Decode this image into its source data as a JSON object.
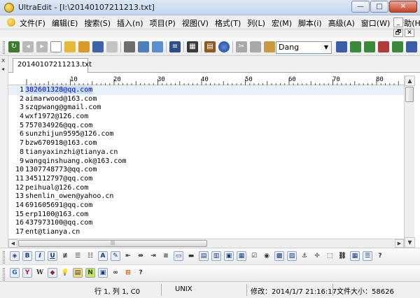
{
  "window": {
    "title": "UltraEdit - [I:\\20140107211213.txt]",
    "minimize": "—",
    "maximize": "□",
    "close": "✕"
  },
  "menu": {
    "items": [
      "文件(F)",
      "编辑(E)",
      "搜索(S)",
      "插入(n)",
      "项目(P)",
      "视图(V)",
      "格式(T)",
      "列(L)",
      "宏(M)",
      "脚本(i)",
      "高级(A)",
      "窗口(W)",
      "帮助(H)"
    ],
    "mdi_minimize": "_",
    "mdi_restore": "🗗",
    "mdi_close": "✕"
  },
  "toolbar": {
    "combo_value": "Dang"
  },
  "tab": {
    "filename": "20140107211213.txt",
    "side_close": "x",
    "side_arrow": "◂"
  },
  "ruler": {
    "labels": [
      "10",
      "20",
      "30",
      "40",
      "50",
      "60",
      "70",
      "80"
    ]
  },
  "editor": {
    "lines": [
      {
        "n": "1",
        "text": "382601328@qq.com"
      },
      {
        "n": "2",
        "text": "aimarwood@163.com"
      },
      {
        "n": "3",
        "text": "szqpwang@gmail.com"
      },
      {
        "n": "4",
        "text": "wxf1972@126.com"
      },
      {
        "n": "5",
        "text": "757034926@qq.com"
      },
      {
        "n": "6",
        "text": "sunzhijun9595@126.com"
      },
      {
        "n": "7",
        "text": "bzw670918@163.com"
      },
      {
        "n": "8",
        "text": "tianyaxinzhi@tianya.cn"
      },
      {
        "n": "9",
        "text": "wangqinshuang.ok@163.com"
      },
      {
        "n": "10",
        "text": "1307748773@qq.com"
      },
      {
        "n": "11",
        "text": "345112797@qq.com"
      },
      {
        "n": "12",
        "text": "peihual@126.com"
      },
      {
        "n": "13",
        "text": "shenlin_owen@yahoo.cn"
      },
      {
        "n": "14",
        "text": "691605691@qq.com"
      },
      {
        "n": "15",
        "text": "erp1100@163.com"
      },
      {
        "n": "16",
        "text": "437973100@qq.com"
      },
      {
        "n": "17",
        "text": "ent@tianya.cn"
      }
    ]
  },
  "status": {
    "position": "行 1, 列 1, C0",
    "encoding": "UNIX",
    "modified": "修改：2014/1/7 21:16:17",
    "filesize": "文件大小：58626"
  }
}
